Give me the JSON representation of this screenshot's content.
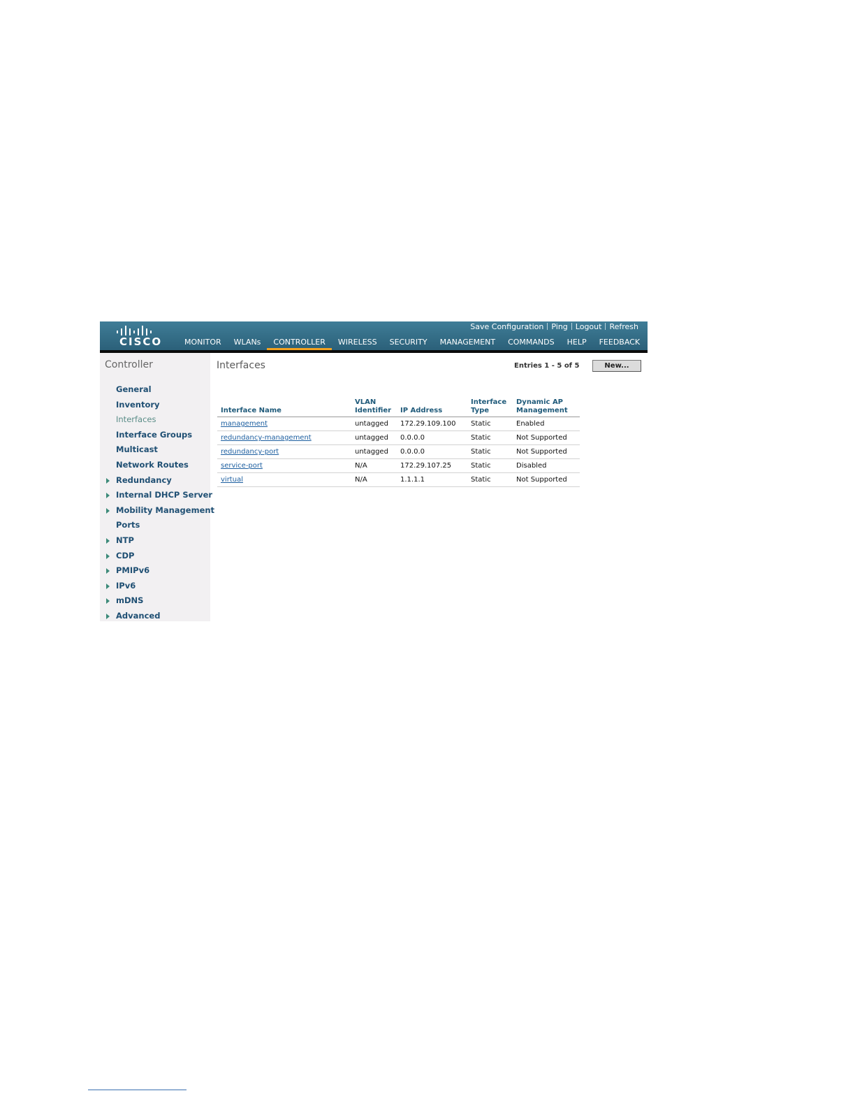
{
  "header": {
    "logo_text": "CISCO",
    "top_links": [
      "Save Configuration",
      "Ping",
      "Logout",
      "Refresh"
    ],
    "nav": [
      "MONITOR",
      "WLANs",
      "CONTROLLER",
      "WIRELESS",
      "SECURITY",
      "MANAGEMENT",
      "COMMANDS",
      "HELP",
      "FEEDBACK"
    ],
    "active_nav": "CONTROLLER",
    "active_color": "#f2a11f"
  },
  "sidebar": {
    "title": "Controller",
    "items": [
      {
        "label": "General",
        "expandable": false
      },
      {
        "label": "Inventory",
        "expandable": false
      },
      {
        "label": "Interfaces",
        "expandable": false,
        "current": true
      },
      {
        "label": "Interface Groups",
        "expandable": false
      },
      {
        "label": "Multicast",
        "expandable": false
      },
      {
        "label": "Network Routes",
        "expandable": false
      },
      {
        "label": "Redundancy",
        "expandable": true
      },
      {
        "label": "Internal DHCP Server",
        "expandable": true
      },
      {
        "label": "Mobility Management",
        "expandable": true
      },
      {
        "label": "Ports",
        "expandable": false
      },
      {
        "label": "NTP",
        "expandable": true
      },
      {
        "label": "CDP",
        "expandable": true
      },
      {
        "label": "PMIPv6",
        "expandable": true
      },
      {
        "label": "IPv6",
        "expandable": true
      },
      {
        "label": "mDNS",
        "expandable": true
      },
      {
        "label": "Advanced",
        "expandable": true
      }
    ]
  },
  "content": {
    "title": "Interfaces",
    "entries_text": "Entries 1 - 5 of 5",
    "new_button": "New...",
    "table": {
      "headers": [
        [
          "Interface Name"
        ],
        [
          "VLAN",
          "Identifier"
        ],
        [
          "IP Address"
        ],
        [
          "Interface",
          "Type"
        ],
        [
          "Dynamic AP",
          "Management"
        ]
      ],
      "rows": [
        [
          "management",
          "untagged",
          "172.29.109.100",
          "Static",
          "Enabled"
        ],
        [
          "redundancy-management",
          "untagged",
          "0.0.0.0",
          "Static",
          "Not Supported"
        ],
        [
          "redundancy-port",
          "untagged",
          "0.0.0.0",
          "Static",
          "Not Supported"
        ],
        [
          "service-port",
          "N/A",
          "172.29.107.25",
          "Static",
          "Disabled"
        ],
        [
          "virtual",
          "N/A",
          "1.1.1.1",
          "Static",
          "Not Supported"
        ]
      ]
    }
  }
}
